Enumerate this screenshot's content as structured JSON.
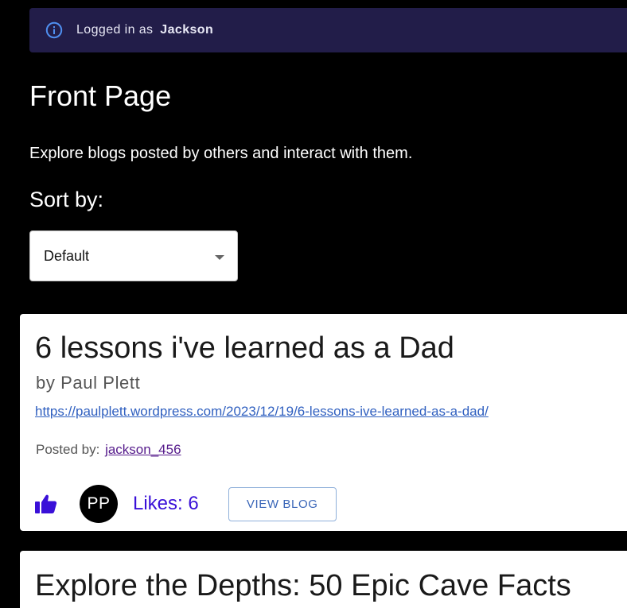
{
  "alert": {
    "prefix": "Logged in as",
    "username": "Jackson",
    "icon": "info-icon",
    "color": "#221d49"
  },
  "page": {
    "title": "Front Page",
    "subtitle": "Explore blogs posted by others and interact with them."
  },
  "sort": {
    "label": "Sort by:",
    "selected": "Default"
  },
  "blogs": [
    {
      "title": "6 lessons i've learned as a Dad",
      "author": "by Paul Plett",
      "url": "https://paulplett.wordpress.com/2023/12/19/6-lessons-ive-learned-as-a-dad/",
      "posted_by_label": "Posted by:",
      "posted_by": "jackson_456",
      "avatar_initials": "PP",
      "likes": "Likes: 6",
      "view_label": "VIEW BLOG"
    },
    {
      "title": "Explore the Depths: 50 Epic Cave Facts"
    }
  ],
  "colors": {
    "background": "#000000",
    "accent": "#3a10d8",
    "link": "#3060c0"
  }
}
